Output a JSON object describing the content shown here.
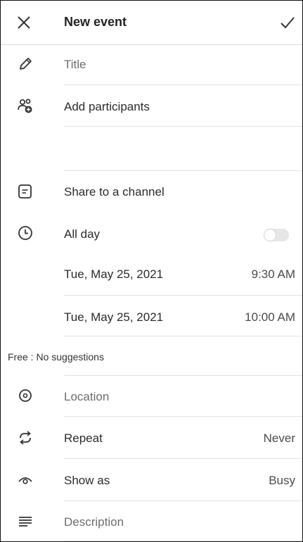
{
  "header": {
    "title": "New event"
  },
  "form": {
    "title_placeholder": "Title",
    "add_participants": "Add participants",
    "share_channel": "Share to a channel",
    "all_day": {
      "label": "All day",
      "enabled": false
    },
    "start": {
      "date": "Tue, May 25, 2021",
      "time": "9:30 AM"
    },
    "end": {
      "date": "Tue, May 25, 2021",
      "time": "10:00 AM"
    },
    "free": {
      "prefix": "Free :",
      "text": "No suggestions"
    },
    "location_placeholder": "Location",
    "repeat": {
      "label": "Repeat",
      "value": "Never"
    },
    "show_as": {
      "label": "Show as",
      "value": "Busy"
    },
    "description_placeholder": "Description"
  },
  "icons": {
    "close": "close-icon",
    "confirm": "checkmark-icon",
    "title": "pencil-icon",
    "participants": "add-people-icon",
    "channel": "channel-icon",
    "all_day": "clock-icon",
    "location": "location-pin-icon",
    "repeat": "repeat-icon",
    "show_as": "eye-icon",
    "description": "text-lines-icon"
  },
  "colors": {
    "accent": "#222222",
    "divider": "#e3e3e3",
    "toggle_off": "#e6e6e6"
  }
}
